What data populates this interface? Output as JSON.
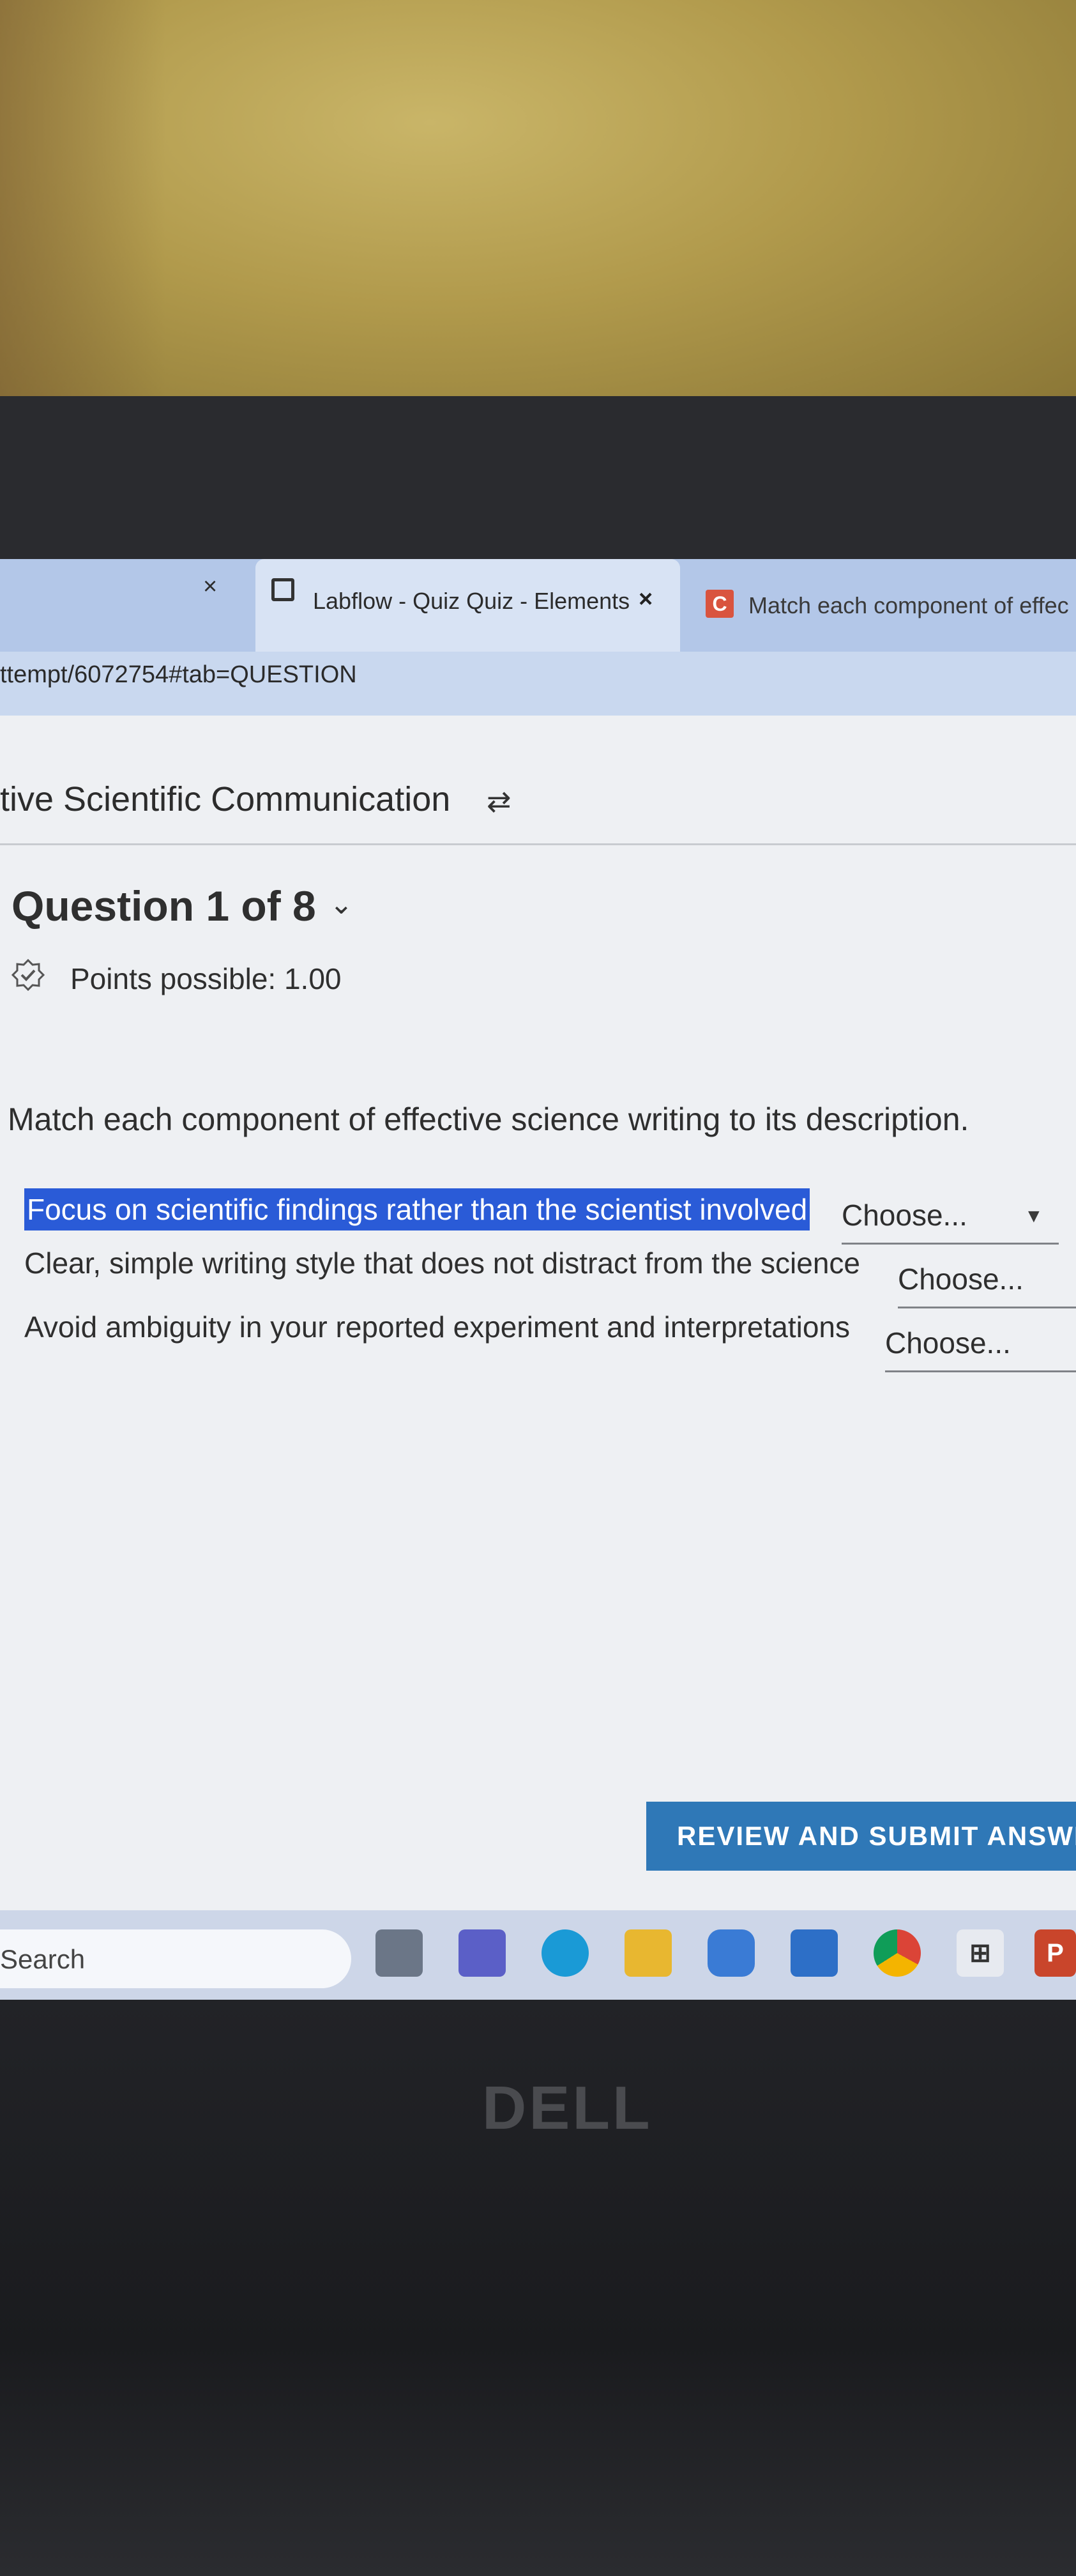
{
  "browser": {
    "tab_active_title": "Labflow - Quiz Quiz - Elements",
    "tab_active_close": "×",
    "tab_left_close": "×",
    "tab2_icon_letter": "C",
    "tab2_title": "Match each component of effec",
    "url": "ttempt/6072754#tab=QUESTION"
  },
  "page": {
    "course_title": "tive Scientific Communication",
    "swap_icon": "⇄",
    "question_title": "Question 1 of 8",
    "question_chevron": "⌄",
    "points_text": "Points possible: 1.00",
    "instruction": "Match each component of effective science writing to its description.",
    "rows": [
      {
        "label": "Focus on scientific findings rather than the scientist involved",
        "selected": "Choose...",
        "highlighted": true
      },
      {
        "label": "Clear, simple writing style that does not distract from the science",
        "selected": "Choose...",
        "highlighted": false
      },
      {
        "label": "Avoid ambiguity in your reported experiment and interpretations",
        "selected": "Choose...",
        "highlighted": false
      }
    ],
    "submit_label": "REVIEW AND SUBMIT ANSWE"
  },
  "taskbar": {
    "search_text": "Search",
    "icons": [
      "task-view-icon",
      "teams-icon",
      "edge-icon",
      "file-explorer-icon",
      "copilot-icon",
      "mail-icon",
      "chrome-icon",
      "store-icon",
      "powerpoint-icon"
    ],
    "store_glyph": "⊞",
    "powerpoint_letter": "P"
  },
  "laptop": {
    "brand": "DELL"
  },
  "colors": {
    "highlight": "#2a5bd7",
    "submit_button": "#2f78b7",
    "tabbar": "#b3c7e8",
    "powerpoint": "#c9452b"
  }
}
